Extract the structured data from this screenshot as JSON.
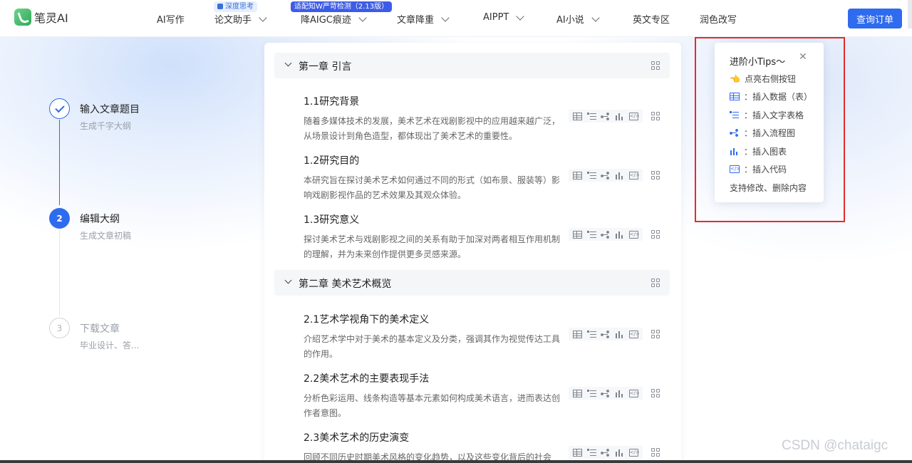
{
  "brand": {
    "name": "笔灵AI"
  },
  "nav": {
    "items": [
      {
        "label": "AI写作",
        "dropdown": false
      },
      {
        "label": "论文助手",
        "dropdown": true
      },
      {
        "label": "降AIGC痕迹",
        "dropdown": true
      },
      {
        "label": "文章降重",
        "dropdown": true
      },
      {
        "label": "AIPPT",
        "dropdown": true
      },
      {
        "label": "AI小说",
        "dropdown": true
      },
      {
        "label": "英文专区",
        "dropdown": false
      },
      {
        "label": "润色改写",
        "dropdown": false
      }
    ],
    "badge_think": "深度思考",
    "badge_aigc": "适配知W严苛检测（2.13版）",
    "query_button": "查询订单"
  },
  "steps": [
    {
      "number": "",
      "title": "输入文章题目",
      "subtitle": "生成千字大纲",
      "state": "done"
    },
    {
      "number": "2",
      "title": "编辑大纲",
      "subtitle": "生成文章初稿",
      "state": "active"
    },
    {
      "number": "3",
      "title": "下载文章",
      "subtitle": "毕业设计、答...",
      "state": "pending"
    }
  ],
  "outline": {
    "chapters": [
      {
        "title": "第一章 引言",
        "sections": [
          {
            "title": "1.1研究背景",
            "desc": "随着多媒体技术的发展，美术艺术在戏剧影视中的应用越来越广泛，从场景设计到角色造型，都体现出了美术艺术的重要性。"
          },
          {
            "title": "1.2研究目的",
            "desc": "本研究旨在探讨美术艺术如何通过不同的形式（如布景、服装等）影响戏剧影视作品的艺术效果及其观众体验。"
          },
          {
            "title": "1.3研究意义",
            "desc": "探讨美术艺术与戏剧影视之间的关系有助于加深对两者相互作用机制的理解，并为未来创作提供更多灵感来源。"
          }
        ]
      },
      {
        "title": "第二章 美术艺术概览",
        "sections": [
          {
            "title": "2.1艺术学视角下的美术定义",
            "desc": "介绍艺术学中对于美术的基本定义及分类，强调其作为视觉传达工具的作用。"
          },
          {
            "title": "2.2美术艺术的主要表现手法",
            "desc": "分析色彩运用、线条构造等基本元素如何构成美术语言，进而表达创作者意图。"
          },
          {
            "title": "2.3美术艺术的历史演变",
            "desc": "回顾不同历史时期美术风格的变化趋势，以及这些变化背后的社会"
          }
        ]
      }
    ]
  },
  "tips": {
    "title": "进阶小Tips～",
    "close": "✕",
    "items": [
      {
        "icon": "hand-pointer-icon",
        "label": "点亮右侧按钮"
      },
      {
        "icon": "table-icon",
        "label": "：插入数据（表）"
      },
      {
        "icon": "list-table-icon",
        "label": "：插入文字表格"
      },
      {
        "icon": "flowchart-icon",
        "label": "：插入流程图"
      },
      {
        "icon": "bar-chart-icon",
        "label": "：插入图表"
      },
      {
        "icon": "code-icon",
        "label": "：插入代码"
      }
    ],
    "footer": "支持修改、删除内容"
  },
  "watermark": "CSDN @chataigc",
  "colors": {
    "accent": "#2f6bef",
    "highlight_box": "#e32b2b"
  }
}
